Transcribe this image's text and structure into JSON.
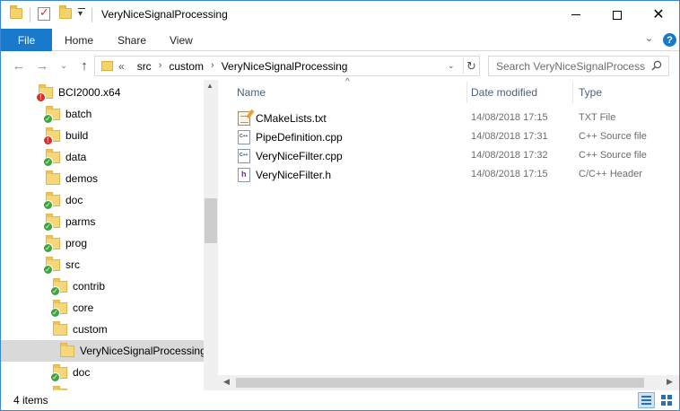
{
  "window": {
    "title": "VeryNiceSignalProcessing",
    "accent": "#1979ca"
  },
  "ribbon": {
    "file": "File",
    "tabs": [
      "Home",
      "Share",
      "View"
    ],
    "help": "?"
  },
  "address": {
    "overflow": "«",
    "crumbs": [
      "src",
      "custom",
      "VeryNiceSignalProcessing"
    ]
  },
  "search": {
    "placeholder": "Search VeryNiceSignalProcess"
  },
  "tree": {
    "items": [
      {
        "label": "BCI2000.x64",
        "badge": "err"
      },
      {
        "label": "batch",
        "badge": "ok"
      },
      {
        "label": "build",
        "badge": "err"
      },
      {
        "label": "data",
        "badge": "ok"
      },
      {
        "label": "demos",
        "badge": "none"
      },
      {
        "label": "doc",
        "badge": "ok"
      },
      {
        "label": "parms",
        "badge": "ok"
      },
      {
        "label": "prog",
        "badge": "ok"
      },
      {
        "label": "src",
        "badge": "ok"
      },
      {
        "label": "contrib",
        "badge": "ok"
      },
      {
        "label": "core",
        "badge": "ok"
      },
      {
        "label": "custom",
        "badge": "none"
      },
      {
        "label": "VeryNiceSignalProcessing",
        "badge": "none"
      },
      {
        "label": "doc",
        "badge": "ok"
      }
    ]
  },
  "columns": {
    "name": "Name",
    "date": "Date modified",
    "type": "Type"
  },
  "files": [
    {
      "name": "CMakeLists.txt",
      "date": "14/08/2018 17:15",
      "type": "TXT File",
      "icon": "txt-file-icon"
    },
    {
      "name": "PipeDefinition.cpp",
      "date": "14/08/2018 17:31",
      "type": "C++ Source file",
      "icon": "cpp-file-icon"
    },
    {
      "name": "VeryNiceFilter.cpp",
      "date": "14/08/2018 17:32",
      "type": "C++ Source file",
      "icon": "cpp-file-icon"
    },
    {
      "name": "VeryNiceFilter.h",
      "date": "14/08/2018 17:15",
      "type": "C/C++ Header",
      "icon": "header-file-icon"
    }
  ],
  "status": {
    "count": "4 items"
  }
}
